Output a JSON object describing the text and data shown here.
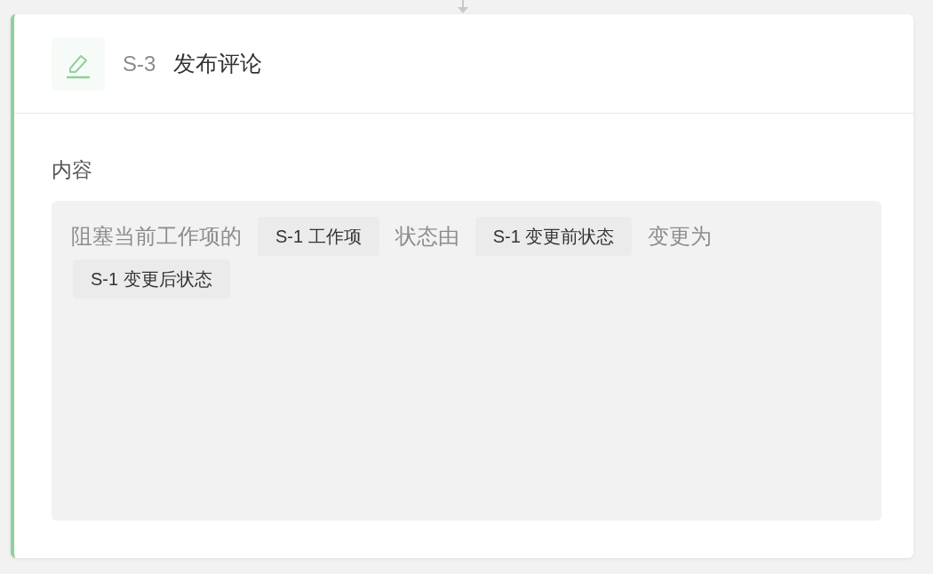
{
  "step": {
    "code": "S-3",
    "title": "发布评论"
  },
  "field": {
    "label": "内容",
    "segments": [
      {
        "kind": "text",
        "text": "阻塞当前工作项的"
      },
      {
        "kind": "token",
        "text": "S-1 工作项"
      },
      {
        "kind": "text",
        "text": "状态由"
      },
      {
        "kind": "token",
        "text": "S-1 变更前状态"
      },
      {
        "kind": "text",
        "text": "变更为"
      },
      {
        "kind": "token",
        "text": "S-1 变更后状态"
      }
    ]
  }
}
